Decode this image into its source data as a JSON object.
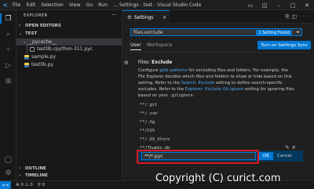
{
  "window": {
    "title": "Settings - test - Visual Studio Code",
    "menu": [
      "File",
      "Edit",
      "Selection",
      "View",
      "Go",
      "Run",
      "..."
    ]
  },
  "sidebar": {
    "title": "EXPLORER",
    "open_editors": "OPEN EDITORS",
    "folder": "TEST",
    "items": [
      {
        "label": "__pycache__",
        "type": "folder"
      },
      {
        "label": "testlib.cpython-311.pyc",
        "type": "pyc"
      },
      {
        "label": "sample.py",
        "type": "py"
      },
      {
        "label": "testlib.py",
        "type": "py"
      }
    ],
    "outline": "OUTLINE",
    "timeline": "TIMELINE"
  },
  "tab": {
    "label": "Settings"
  },
  "settings": {
    "search_value": "files.exclude",
    "found_badge": "1 Setting Found",
    "scope_tabs": [
      "User",
      "Workspace"
    ],
    "sync_button": "Turn on Settings Sync",
    "setting_prefix": "Files: ",
    "setting_name": "Exclude",
    "desc_1": "Configure ",
    "desc_link_1": "glob patterns",
    "desc_2": " for excluding files and folders. For example, the File Explorer decides which files and folders to show or hide based on this setting. Refer to the ",
    "desc_link_2": "Search: Exclude",
    "desc_3": " setting to define search-specific excludes. Refer to the ",
    "desc_link_3": "Explorer: Exclude Git Ignore",
    "desc_4": " setting for ignoring files based on your ",
    "desc_mono": ".gitignore",
    "desc_5": ".",
    "patterns": [
      "**/.git",
      "**/.svn",
      "**/.hg",
      "**/CVS",
      "**/.DS_Store",
      "**/Thumbs.db"
    ],
    "edit_value": "**/*.pyc",
    "ok_label": "OK",
    "cancel_label": "Cancel"
  },
  "statusbar": {
    "remote": "><",
    "errors": "⊗ 0 ⚠ 0",
    "ports": "⚲ 0"
  },
  "watermark": "Copyright (C) curict.com",
  "colors": {
    "accent": "#0078d4",
    "highlight": "#e0191f"
  }
}
